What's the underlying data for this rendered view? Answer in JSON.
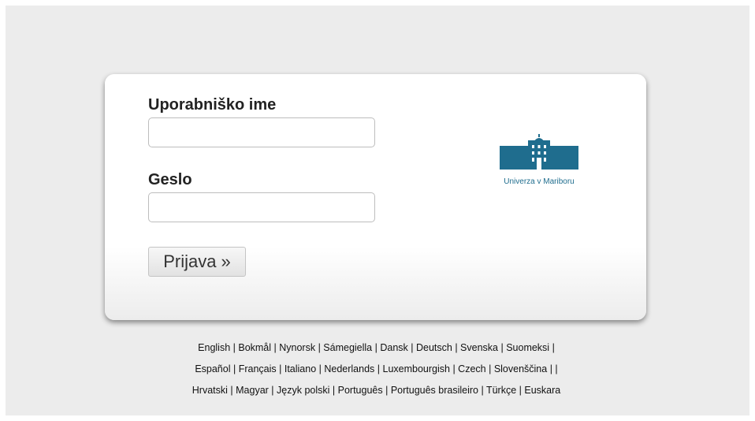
{
  "login": {
    "username_label": "Uporabniško ime",
    "username_value": "",
    "password_label": "Geslo",
    "password_value": "",
    "submit_label": "Prijava »"
  },
  "logo": {
    "text": "Univerza v Mariboru",
    "color": "#1f6d8e"
  },
  "languages": [
    [
      "English",
      "Bokmål",
      "Nynorsk",
      "Sámegiella",
      "Dansk",
      "Deutsch",
      "Svenska",
      "Suomeksi",
      ""
    ],
    [
      "Español",
      "Français",
      "Italiano",
      "Nederlands",
      "Luxembourgish",
      "Czech",
      "Slovenščina",
      "",
      ""
    ],
    [
      "Hrvatski",
      "Magyar",
      "Język polski",
      "Português",
      "Português brasileiro",
      "Türkçe",
      "Euskara"
    ]
  ]
}
